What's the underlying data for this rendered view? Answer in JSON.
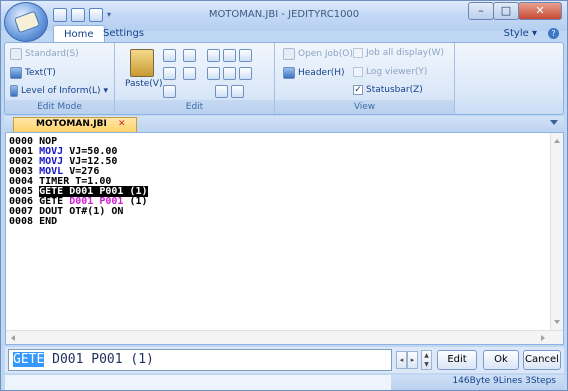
{
  "window": {
    "title": "MOTOMAN.JBI - JEDITYRC1000"
  },
  "ribbon": {
    "tabs": [
      {
        "label": "Home"
      },
      {
        "label": "Settings"
      }
    ],
    "style_label": "Style",
    "groups": {
      "edit_mode": {
        "label": "Edit Mode",
        "items": [
          {
            "label": "Standard(S)",
            "enabled": false
          },
          {
            "label": "Text(T)",
            "enabled": true
          },
          {
            "label": "Level of Inform(L)",
            "enabled": true
          }
        ]
      },
      "edit": {
        "label": "Edit",
        "paste_label": "Paste(V)"
      },
      "view": {
        "label": "View",
        "open_job": "Open Job(O)",
        "header": "Header(H)",
        "job_all_display": "Job all display(W)",
        "log_viewer": "Log viewer(Y)",
        "statusbar": "Statusbar(Z)",
        "statusbar_checked": true
      }
    }
  },
  "document": {
    "tab_label": "MOTOMAN.JBI",
    "lines": [
      {
        "num": "0000",
        "text": "NOP"
      },
      {
        "num": "0001",
        "cmd": "MOVJ",
        "args": "VJ=50.00"
      },
      {
        "num": "0002",
        "cmd": "MOVJ",
        "args": "VJ=12.50"
      },
      {
        "num": "0003",
        "cmd": "MOVL",
        "args": "V=276"
      },
      {
        "num": "0004",
        "text": "TIMER T=1.00"
      },
      {
        "num": "0005",
        "text": "GETE D001 P001 (1)"
      },
      {
        "num": "0006",
        "cmd": "GETE",
        "args_pink": "D001 P001",
        "args": "(1)"
      },
      {
        "num": "0007",
        "text": "DOUT OT#(1) ON"
      },
      {
        "num": "0008",
        "text": "END"
      }
    ]
  },
  "command_bar": {
    "selected_text": "GETE",
    "rest_text": " D001 P001 (1)",
    "edit_label": "Edit",
    "ok_label": "Ok",
    "cancel_label": "Cancel"
  },
  "statusbar": {
    "info": "146Byte  9Lines  3Steps"
  },
  "icons": {
    "app_orb": "app-menu-icon",
    "close": "close-icon",
    "minimize": "minimize-icon",
    "maximize": "maximize-icon",
    "help": "help-icon"
  }
}
